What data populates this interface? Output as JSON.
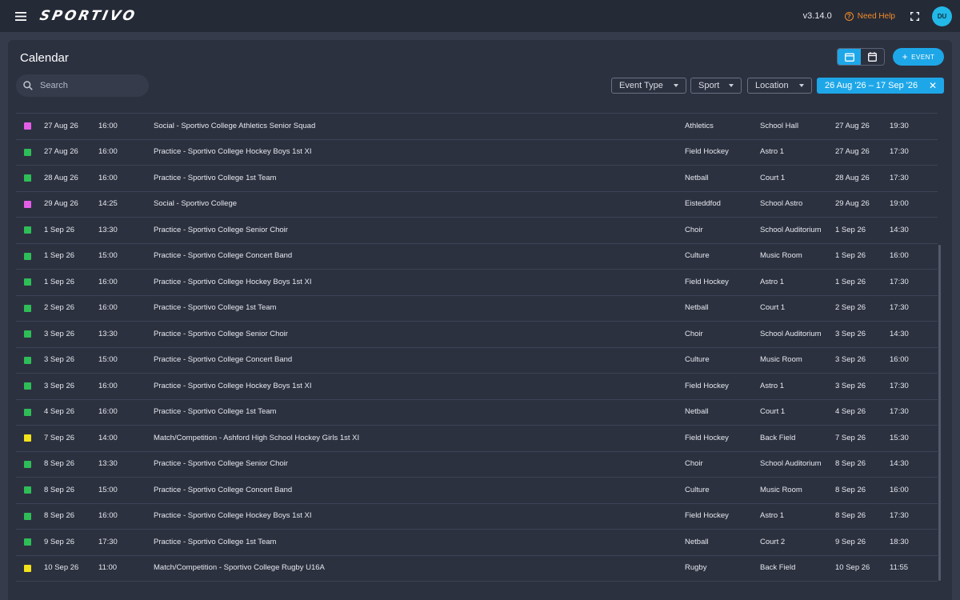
{
  "app": {
    "logo": "SPORTIVO",
    "version": "v3.14.0",
    "help_label": "Need Help",
    "avatar_initials": "DU"
  },
  "page": {
    "title": "Calendar",
    "add_event_label": "EVENT",
    "search_placeholder": "Search",
    "filters": {
      "event_type": "Event Type",
      "sport": "Sport",
      "location": "Location"
    },
    "date_range": "26 Aug '26 – 17 Sep '26",
    "view_mode": "list"
  },
  "colors": {
    "social": "#e35ee6",
    "practice": "#2ebd57",
    "match": "#f2e21a",
    "accent": "#1ea7e8"
  },
  "events": [
    {
      "type": "social",
      "date": "27 Aug 26",
      "time": "16:00",
      "title": "Social - Sportivo College Athletics Senior Squad",
      "sport": "Athletics",
      "location": "School Hall",
      "end_date": "27 Aug 26",
      "end_time": "19:30"
    },
    {
      "type": "practice",
      "date": "27 Aug 26",
      "time": "16:00",
      "title": "Practice - Sportivo College Hockey Boys 1st XI",
      "sport": "Field Hockey",
      "location": "Astro 1",
      "end_date": "27 Aug 26",
      "end_time": "17:30"
    },
    {
      "type": "practice",
      "date": "28 Aug 26",
      "time": "16:00",
      "title": "Practice - Sportivo College 1st Team",
      "sport": "Netball",
      "location": "Court 1",
      "end_date": "28 Aug 26",
      "end_time": "17:30"
    },
    {
      "type": "social",
      "date": "29 Aug 26",
      "time": "14:25",
      "title": "Social - Sportivo College",
      "sport": "Eisteddfod",
      "location": "School Astro",
      "end_date": "29 Aug 26",
      "end_time": "19:00"
    },
    {
      "type": "practice",
      "date": "1 Sep 26",
      "time": "13:30",
      "title": "Practice - Sportivo College Senior Choir",
      "sport": "Choir",
      "location": "School Auditorium",
      "end_date": "1 Sep 26",
      "end_time": "14:30"
    },
    {
      "type": "practice",
      "date": "1 Sep 26",
      "time": "15:00",
      "title": "Practice - Sportivo College Concert Band",
      "sport": "Culture",
      "location": "Music Room",
      "end_date": "1 Sep 26",
      "end_time": "16:00"
    },
    {
      "type": "practice",
      "date": "1 Sep 26",
      "time": "16:00",
      "title": "Practice - Sportivo College Hockey Boys 1st XI",
      "sport": "Field Hockey",
      "location": "Astro 1",
      "end_date": "1 Sep 26",
      "end_time": "17:30"
    },
    {
      "type": "practice",
      "date": "2 Sep 26",
      "time": "16:00",
      "title": "Practice - Sportivo College 1st Team",
      "sport": "Netball",
      "location": "Court 1",
      "end_date": "2 Sep 26",
      "end_time": "17:30"
    },
    {
      "type": "practice",
      "date": "3 Sep 26",
      "time": "13:30",
      "title": "Practice - Sportivo College Senior Choir",
      "sport": "Choir",
      "location": "School Auditorium",
      "end_date": "3 Sep 26",
      "end_time": "14:30"
    },
    {
      "type": "practice",
      "date": "3 Sep 26",
      "time": "15:00",
      "title": "Practice - Sportivo College Concert Band",
      "sport": "Culture",
      "location": "Music Room",
      "end_date": "3 Sep 26",
      "end_time": "16:00"
    },
    {
      "type": "practice",
      "date": "3 Sep 26",
      "time": "16:00",
      "title": "Practice - Sportivo College Hockey Boys 1st XI",
      "sport": "Field Hockey",
      "location": "Astro 1",
      "end_date": "3 Sep 26",
      "end_time": "17:30"
    },
    {
      "type": "practice",
      "date": "4 Sep 26",
      "time": "16:00",
      "title": "Practice - Sportivo College 1st Team",
      "sport": "Netball",
      "location": "Court 1",
      "end_date": "4 Sep 26",
      "end_time": "17:30"
    },
    {
      "type": "match",
      "date": "7 Sep 26",
      "time": "14:00",
      "title": "Match/Competition - Ashford High School Hockey Girls 1st XI",
      "sport": "Field Hockey",
      "location": "Back Field",
      "end_date": "7 Sep 26",
      "end_time": "15:30"
    },
    {
      "type": "practice",
      "date": "8 Sep 26",
      "time": "13:30",
      "title": "Practice - Sportivo College Senior Choir",
      "sport": "Choir",
      "location": "School Auditorium",
      "end_date": "8 Sep 26",
      "end_time": "14:30"
    },
    {
      "type": "practice",
      "date": "8 Sep 26",
      "time": "15:00",
      "title": "Practice - Sportivo College Concert Band",
      "sport": "Culture",
      "location": "Music Room",
      "end_date": "8 Sep 26",
      "end_time": "16:00"
    },
    {
      "type": "practice",
      "date": "8 Sep 26",
      "time": "16:00",
      "title": "Practice - Sportivo College Hockey Boys 1st XI",
      "sport": "Field Hockey",
      "location": "Astro 1",
      "end_date": "8 Sep 26",
      "end_time": "17:30"
    },
    {
      "type": "practice",
      "date": "9 Sep 26",
      "time": "17:30",
      "title": "Practice - Sportivo College 1st Team",
      "sport": "Netball",
      "location": "Court 2",
      "end_date": "9 Sep 26",
      "end_time": "18:30"
    },
    {
      "type": "match",
      "date": "10 Sep 26",
      "time": "11:00",
      "title": "Match/Competition - Sportivo College Rugby U16A",
      "sport": "Rugby",
      "location": "Back Field",
      "end_date": "10 Sep 26",
      "end_time": "11:55"
    }
  ]
}
